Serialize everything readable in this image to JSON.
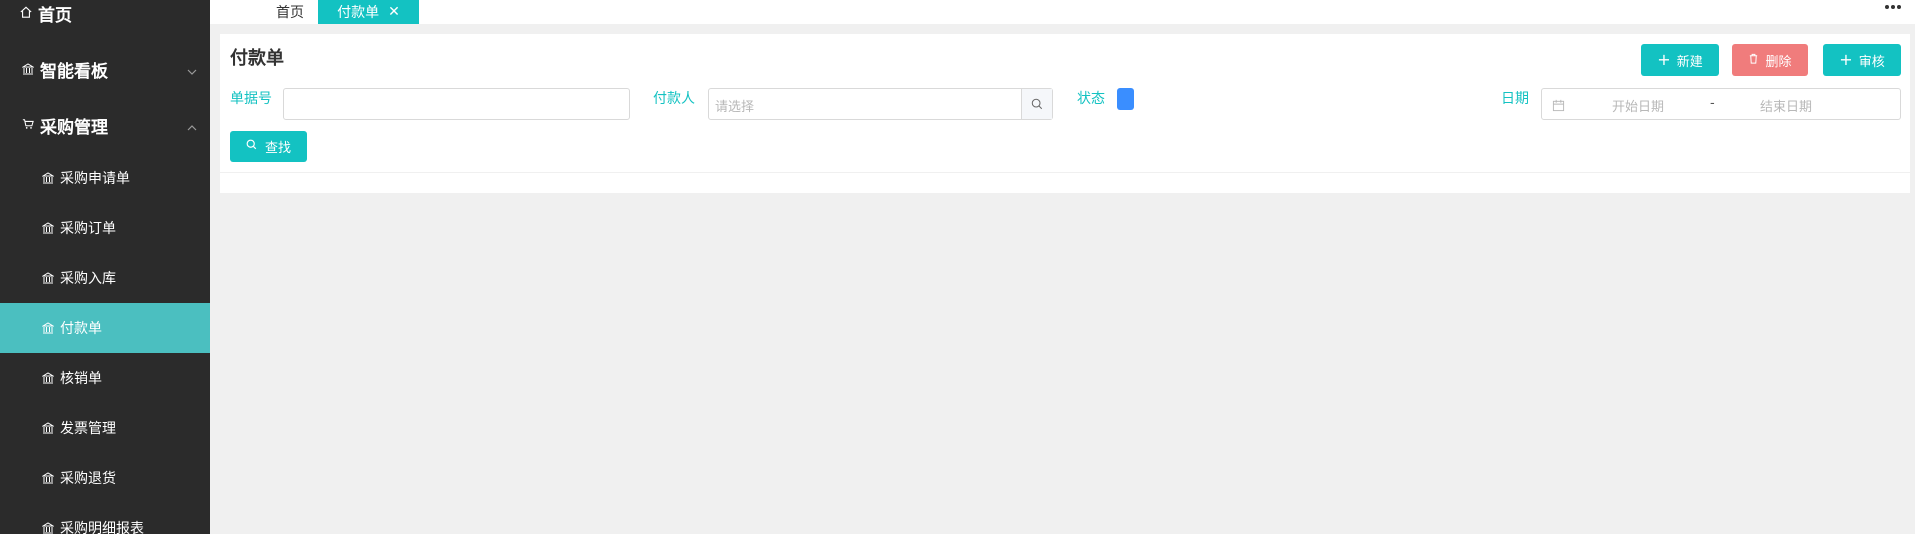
{
  "sidebar": {
    "home": "首页",
    "dashboard": "智能看板",
    "purchase": "采购管理",
    "items": [
      {
        "label": "采购申请单"
      },
      {
        "label": "采购订单"
      },
      {
        "label": "采购入库"
      },
      {
        "label": "付款单"
      },
      {
        "label": "核销单"
      },
      {
        "label": "发票管理"
      },
      {
        "label": "采购退货"
      },
      {
        "label": "采购明细报表"
      }
    ],
    "active_index": 3
  },
  "tabs": {
    "home": "首页",
    "active": "付款单",
    "close": "✕"
  },
  "page": {
    "title": "付款单"
  },
  "toolbar": {
    "new_label": "新建",
    "delete_label": "删除",
    "audit_label": "审核"
  },
  "filters": {
    "doc_no_label": "单据号",
    "doc_no_value": "",
    "payer_label": "付款人",
    "payer_placeholder": "请选择",
    "status_label": "状态",
    "date_label": "日期",
    "start_placeholder": "开始日期",
    "separator": "-",
    "end_placeholder": "结束日期",
    "search_label": "查找"
  },
  "colors": {
    "sidebar_bg": "#2b2b2b",
    "active_item": "#4bbfc0",
    "accent": "#13c2c2",
    "danger": "#f07c7c",
    "status_blue": "#3a8eff"
  }
}
